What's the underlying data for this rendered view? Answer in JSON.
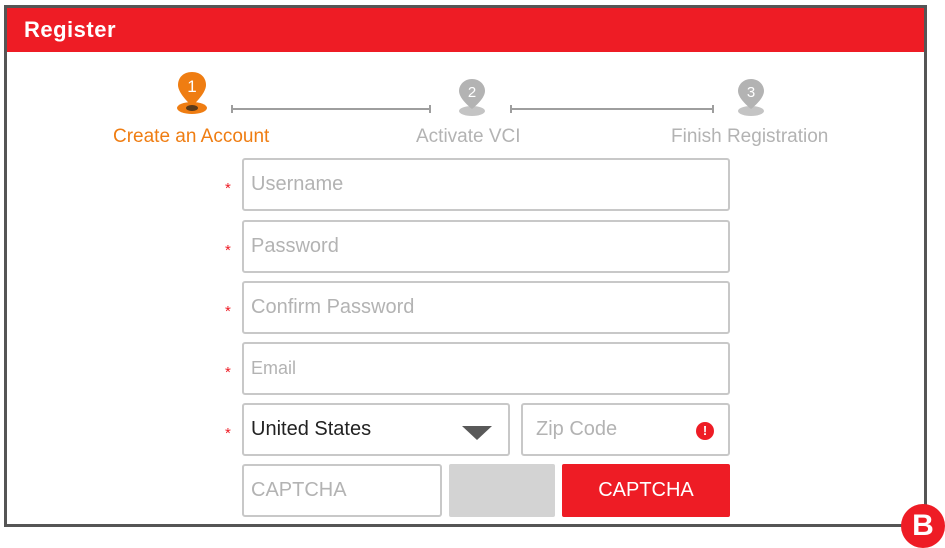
{
  "window": {
    "title": "Register"
  },
  "steps": [
    {
      "number": "1",
      "label": "Create an Account",
      "state": "active"
    },
    {
      "number": "2",
      "label": "Activate VCI",
      "state": "inactive"
    },
    {
      "number": "3",
      "label": "Finish Registration",
      "state": "inactive"
    }
  ],
  "colors": {
    "accent": "#ee1c25",
    "active_step": "#ef7d12",
    "inactive_step": "#b3b3b3"
  },
  "form": {
    "required_marker": "*",
    "username": {
      "placeholder": "Username",
      "value": ""
    },
    "password": {
      "placeholder": "Password",
      "value": ""
    },
    "confirm_password": {
      "placeholder": "Confirm  Password",
      "value": ""
    },
    "email": {
      "placeholder": "Email",
      "value": ""
    },
    "country": {
      "value": "United States"
    },
    "zip": {
      "placeholder": "Zip Code",
      "value": "",
      "error_icon": "!"
    },
    "captcha": {
      "placeholder": "CAPTCHA",
      "value": "",
      "button_label": "CAPTCHA"
    }
  },
  "badge": {
    "label": "B"
  }
}
